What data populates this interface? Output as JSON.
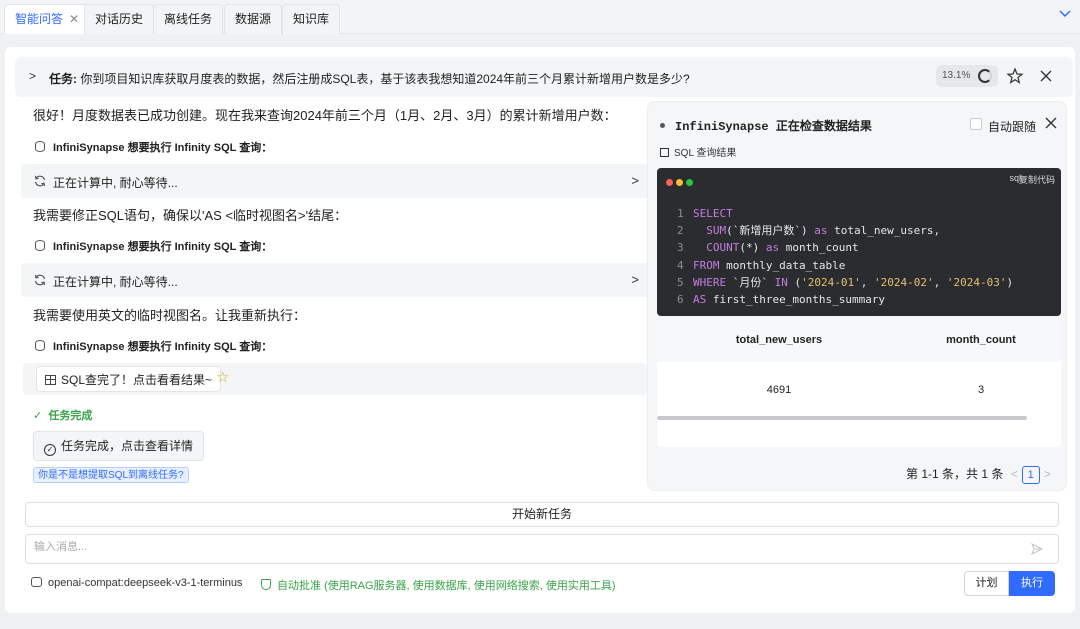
{
  "tabs": [
    {
      "label": "智能问答",
      "active": true
    },
    {
      "label": "对话历史"
    },
    {
      "label": "离线任务"
    },
    {
      "label": "数据源"
    },
    {
      "label": "知识库"
    }
  ],
  "task": {
    "prefix": "任务:",
    "text": "你到项目知识库获取月度表的数据，然后注册成SQL表，基于该表我想知道2024年前三个月累计新增用户数是多少?",
    "progress_label": "13.1%",
    "progress": 0.131
  },
  "chat": {
    "msg1": "很好！月度数据表已成功创建。现在我来查询2024年前三个月（1月、2月、3月）的累计新增用户数：",
    "tool_head": "InfiniSynapse 想要执行 Infinity SQL 查询：",
    "running": "正在计算中, 耐心等待...",
    "msg2": "我需要修正SQL语句，确保以'AS <临时视图名>'结尾：",
    "msg3": "我需要使用英文的临时视图名。让我重新执行：",
    "result_btn": "SQL查完了！点击看看结果~",
    "done": "任务完成",
    "done_btn": "任务完成，点击查看详情",
    "suggest": "你是不是想提取SQL到离线任务?"
  },
  "panel": {
    "title": "InfiniSynapse 正在检查数据结果",
    "auto_follow": "自动跟随",
    "subtitle": "SQL 查询结果",
    "code_lang": "sql",
    "copy": "复制代码",
    "code_lines": [
      "SELECT",
      "  SUM(`新增用户数`) as total_new_users,",
      "  COUNT(*) as month_count",
      "FROM monthly_data_table",
      "WHERE `月份` IN ('2024-01', '2024-02', '2024-03')",
      "AS first_three_months_summary"
    ],
    "columns": [
      "total_new_users",
      "month_count"
    ],
    "rows": [
      [
        "4691",
        "3"
      ]
    ],
    "pager_text": "第 1-1 条，共 1 条",
    "page": "1"
  },
  "footer": {
    "new_task": "开始新任务",
    "input_placeholder": "输入消息...",
    "model": "openai-compat:deepseek-v3-1-terminus",
    "approve": "自动批准 (使用RAG服务器, 使用数据库, 使用网络搜索, 使用实用工具)",
    "plan": "计划",
    "exec": "执行"
  },
  "colors": {
    "accent": "#2f6bff",
    "success": "#39a34a",
    "code_bg": "#2b2c30"
  }
}
